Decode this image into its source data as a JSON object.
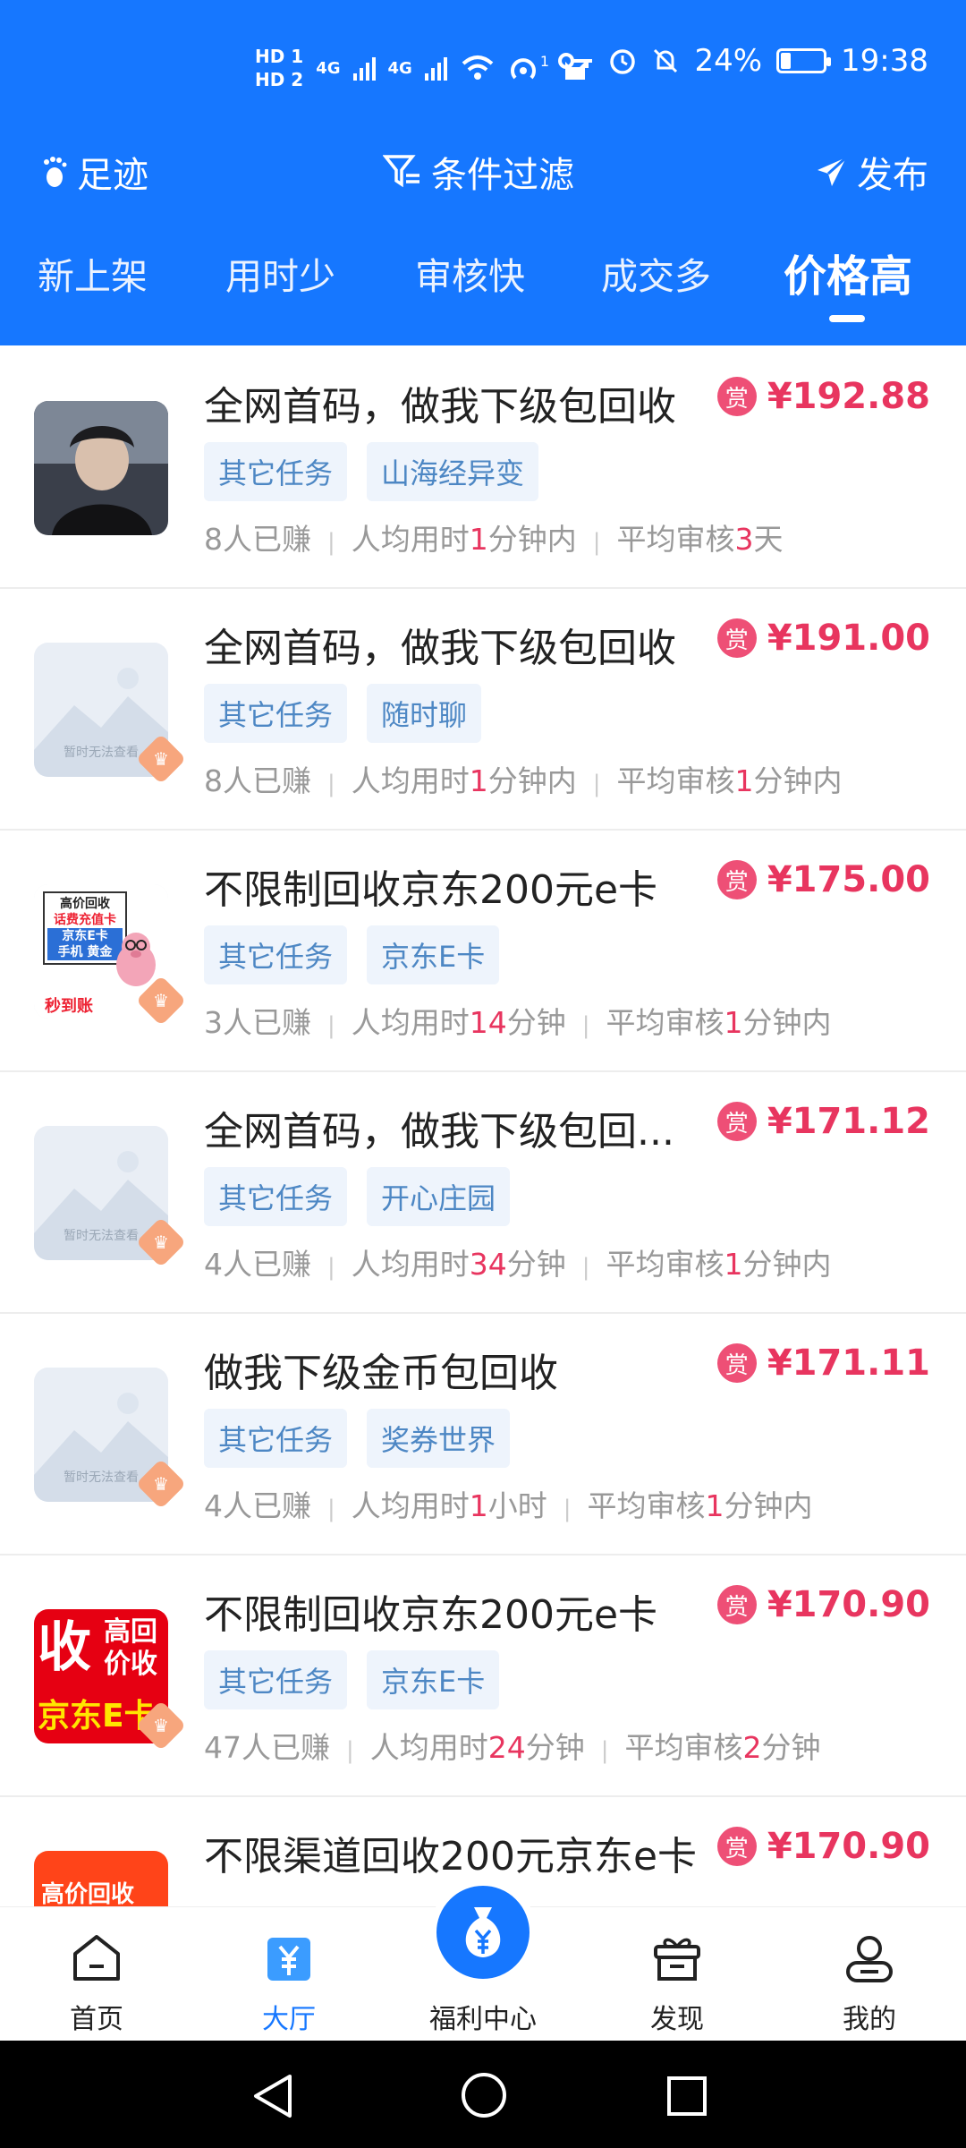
{
  "status_bar": {
    "hd1": "HD 1",
    "hd2": "HD 2",
    "net1": "4G",
    "net2": "4G",
    "hotspot_count": "1",
    "battery": "24%",
    "battery_level": 0.24,
    "time": "19:38"
  },
  "toolbar": {
    "footprint": "足迹",
    "filter": "条件过滤",
    "publish": "发布"
  },
  "sort_tabs": [
    "新上架",
    "用时少",
    "审核快",
    "成交多",
    "价格高"
  ],
  "reward_badge": "赏",
  "items": [
    {
      "title": "全网首码，做我下级包回收",
      "price": "¥192.88",
      "tags": [
        "其它任务",
        "山海经异变"
      ],
      "earned": [
        "8",
        "人已赚"
      ],
      "time": [
        "人均用时",
        "1",
        "分钟内"
      ],
      "review": [
        "平均审核",
        "3",
        "天"
      ],
      "thumb": "photo",
      "crown": false
    },
    {
      "title": "全网首码，做我下级包回收",
      "price": "¥191.00",
      "tags": [
        "其它任务",
        "随时聊"
      ],
      "earned": [
        "8",
        "人已赚"
      ],
      "time": [
        "人均用时",
        "1",
        "分钟内"
      ],
      "review": [
        "平均审核",
        "1",
        "分钟内"
      ],
      "thumb": "placeholder",
      "crown": true
    },
    {
      "title": "不限制回收京东200元e卡",
      "price": "¥175.00",
      "tags": [
        "其它任务",
        "京东E卡"
      ],
      "earned": [
        "3",
        "人已赚"
      ],
      "time": [
        "人均用时",
        "14",
        "分钟"
      ],
      "review": [
        "平均审核",
        "1",
        "分钟内"
      ],
      "thumb": "pig",
      "crown": true
    },
    {
      "title": "全网首码，做我下级包回...",
      "price": "¥171.12",
      "tags": [
        "其它任务",
        "开心庄园"
      ],
      "earned": [
        "4",
        "人已赚"
      ],
      "time": [
        "人均用时",
        "34",
        "分钟"
      ],
      "review": [
        "平均审核",
        "1",
        "分钟内"
      ],
      "thumb": "placeholder",
      "crown": true
    },
    {
      "title": "做我下级金币包回收",
      "price": "¥171.11",
      "tags": [
        "其它任务",
        "奖券世界"
      ],
      "earned": [
        "4",
        "人已赚"
      ],
      "time": [
        "人均用时",
        "1",
        "小时"
      ],
      "review": [
        "平均审核",
        "1",
        "分钟内"
      ],
      "thumb": "placeholder",
      "crown": true
    },
    {
      "title": "不限制回收京东200元e卡",
      "price": "¥170.90",
      "tags": [
        "其它任务",
        "京东E卡"
      ],
      "earned": [
        "47",
        "人已赚"
      ],
      "time": [
        "人均用时",
        "24",
        "分钟"
      ],
      "review": [
        "平均审核",
        "2",
        "分钟"
      ],
      "thumb": "red",
      "crown": true
    },
    {
      "title": "不限渠道回收200元京东e卡",
      "price": "¥170.90",
      "tags": [],
      "earned": [
        "",
        ""
      ],
      "time": [
        "",
        "",
        ""
      ],
      "review": [
        "",
        "",
        ""
      ],
      "thumb": "orange",
      "crown": false
    }
  ],
  "thumb_text": {
    "placeholder": "暂时无法查看",
    "pig_lines": [
      "高价回收",
      "话费充值卡",
      "京东E卡",
      "手机 黄金"
    ],
    "pig_footer": "秒到账",
    "red_big": "收",
    "red_side": [
      "高回",
      "价收"
    ],
    "red_bottom": "京东E卡",
    "orange": "高价回收"
  },
  "bottom_nav": {
    "home": "首页",
    "hall": "大厅",
    "welfare": "福利中心",
    "discover": "发现",
    "mine": "我的"
  },
  "colors": {
    "brand": "#1677ff",
    "price": "#e8355f",
    "tag_text": "#4d87c4",
    "tag_bg": "#eef4fc"
  }
}
